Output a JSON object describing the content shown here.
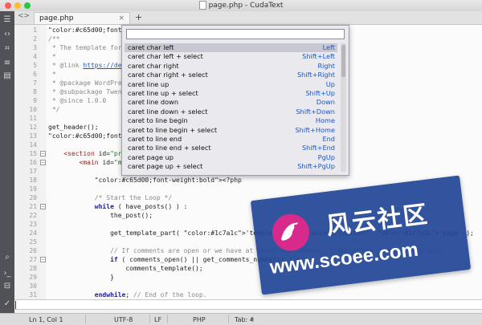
{
  "window": {
    "title": "page.php - CudaText"
  },
  "tabs": [
    {
      "label": "page.php",
      "close": "×"
    }
  ],
  "tab_add_label": "+",
  "tab_nav": "<>",
  "sidebar_icons": [
    "menu-icon",
    "code-icon",
    "tree-icon",
    "list-icon",
    "panel-icon",
    "search-icon",
    "console-icon",
    "validate-icon",
    "check-icon"
  ],
  "code_lines": [
    {
      "n": "1",
      "t": "<?php"
    },
    {
      "n": "2",
      "t": "/**"
    },
    {
      "n": "3",
      "t": " * The template for dis"
    },
    {
      "n": "4",
      "t": " *"
    },
    {
      "n": "5",
      "t": " * @link https://develo"
    },
    {
      "n": "6",
      "t": " *"
    },
    {
      "n": "7",
      "t": " * @package WordPress"
    },
    {
      "n": "8",
      "t": " * @subpackage Twenty_T"
    },
    {
      "n": "9",
      "t": " * @since 1.0.0"
    },
    {
      "n": "10",
      "t": " */"
    },
    {
      "n": "11",
      "t": ""
    },
    {
      "n": "12",
      "t": "get_header();"
    },
    {
      "n": "13",
      "t": "?>"
    },
    {
      "n": "14",
      "t": ""
    },
    {
      "n": "15",
      "t": "    <section id=\"primar"
    },
    {
      "n": "16",
      "t": "        <main id=\"main\""
    },
    {
      "n": "17",
      "t": ""
    },
    {
      "n": "18",
      "t": "            <?php"
    },
    {
      "n": "19",
      "t": ""
    },
    {
      "n": "20",
      "t": "            /* Start the Loop */"
    },
    {
      "n": "21",
      "t": "            while ( have_posts() ) :"
    },
    {
      "n": "22",
      "t": "                the_post();"
    },
    {
      "n": "23",
      "t": ""
    },
    {
      "n": "24",
      "t": "                get_template_part( 'template-parts/content/content', 'page' );"
    },
    {
      "n": "25",
      "t": ""
    },
    {
      "n": "26",
      "t": "                // If comments are open or we have at least one comment, load up the comment template."
    },
    {
      "n": "27",
      "t": "                if ( comments_open() || get_comments_number() ) {"
    },
    {
      "n": "28",
      "t": "                    comments_template();"
    },
    {
      "n": "29",
      "t": "                }"
    },
    {
      "n": "30",
      "t": ""
    },
    {
      "n": "31",
      "t": "            endwhile; // End of the loop."
    },
    {
      "n": "32",
      "t": "            ?>"
    }
  ],
  "command_palette": {
    "input_value": "",
    "items": [
      {
        "label": "caret char left",
        "key": "Left",
        "selected": true
      },
      {
        "label": "caret char left + select",
        "key": "Shift+Left"
      },
      {
        "label": "caret char right",
        "key": "Right"
      },
      {
        "label": "caret char right + select",
        "key": "Shift+Right"
      },
      {
        "label": "caret line up",
        "key": "Up"
      },
      {
        "label": "caret line up + select",
        "key": "Shift+Up"
      },
      {
        "label": "caret line down",
        "key": "Down"
      },
      {
        "label": "caret line down + select",
        "key": "Shift+Down"
      },
      {
        "label": "caret to line begin",
        "key": "Home"
      },
      {
        "label": "caret to line begin + select",
        "key": "Shift+Home"
      },
      {
        "label": "caret to line end",
        "key": "End"
      },
      {
        "label": "caret to line end + select",
        "key": "Shift+End"
      },
      {
        "label": "caret page up",
        "key": "PgUp"
      },
      {
        "label": "caret page up + select",
        "key": "Shift+PgUp"
      }
    ]
  },
  "watermark": {
    "chinese": "风云社区",
    "url": "www.scoee.com"
  },
  "status": {
    "position": "Ln 1, Col 1",
    "encoding": "UTF-8",
    "line_ending": "LF",
    "lexer": "PHP",
    "tab": "Tab: 4"
  },
  "colors": {
    "keyword": "#1d1da0",
    "string": "#1c7a1c",
    "comment": "#8a8a8a",
    "tag": "#a01919",
    "php": "#c65d00",
    "link": "#1a58c7",
    "shortcut": "#1a58c7",
    "watermark_bg": "#2446a0",
    "watermark_logo": "#d72a8a",
    "sidebar": "#505257"
  }
}
